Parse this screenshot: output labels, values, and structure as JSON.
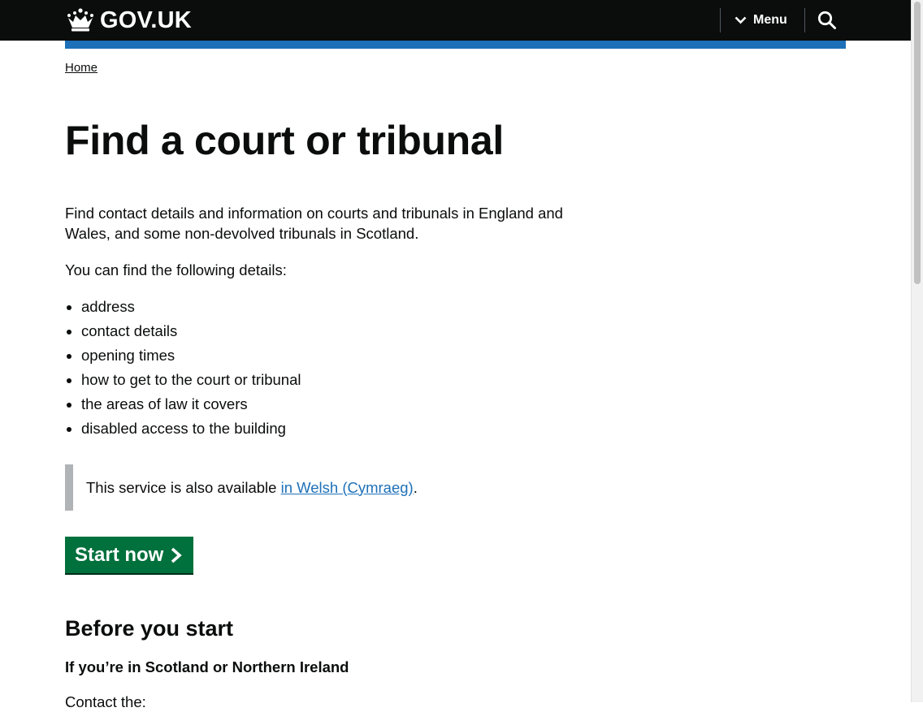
{
  "header": {
    "logo_text": "GOV.UK",
    "menu_label": "Menu",
    "brand_color": "#1d70b8",
    "icons": [
      "crown-icon",
      "chevron-down-icon",
      "search-icon"
    ]
  },
  "breadcrumb": {
    "home": "Home"
  },
  "main": {
    "title": "Find a court or tribunal",
    "lede": "Find contact details and information on courts and tribunals in England and Wales, and some non-devolved tribunals in Scotland.",
    "intro": "You can find the following details:",
    "details": [
      "address",
      "contact details",
      "opening times",
      "how to get to the court or tribunal",
      "the areas of law it covers",
      "disabled access to the building"
    ],
    "inset": {
      "text_before": "This service is also available ",
      "link": "in Welsh (Cymraeg)",
      "text_after": "."
    },
    "start_button": "Start now",
    "start_button_color": "#00703c",
    "before_heading": "Before you start",
    "scotland_heading": "If you’re in Scotland or Northern Ireland",
    "contact_text": "Contact the:"
  }
}
